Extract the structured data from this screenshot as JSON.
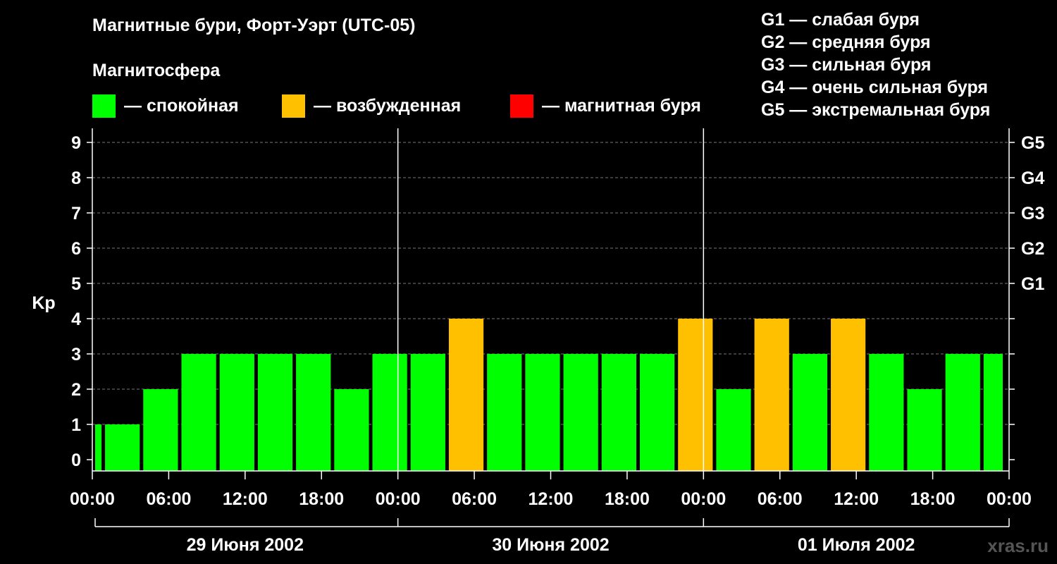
{
  "title": "Магнитные бури, Форт-Уэрт (UTC-05)",
  "magnetosphere_label": "Магнитосфера",
  "legend": [
    {
      "label": "— спокойная",
      "color": "#00ff00"
    },
    {
      "label": "— возбужденная",
      "color": "#ffc000"
    },
    {
      "label": "— магнитная буря",
      "color": "#ff0000"
    }
  ],
  "g_levels": [
    "G1 — слабая буря",
    "G2 — средняя буря",
    "G3 — сильная буря",
    "G4 — очень сильная буря",
    "G5 — экстремальная буря"
  ],
  "watermark": "xras.ru",
  "chart_data": {
    "type": "bar",
    "ylabel": "Kp",
    "ylim": [
      0,
      9
    ],
    "yticks": [
      0,
      1,
      2,
      3,
      4,
      5,
      6,
      7,
      8,
      9
    ],
    "right_ticks": [
      {
        "value": 5,
        "label": "G1"
      },
      {
        "value": 6,
        "label": "G2"
      },
      {
        "value": 7,
        "label": "G3"
      },
      {
        "value": 8,
        "label": "G4"
      },
      {
        "value": 9,
        "label": "G5"
      }
    ],
    "xlim_hours": [
      0,
      72
    ],
    "xtick_labels": [
      "00:00",
      "06:00",
      "12:00",
      "18:00",
      "00:00",
      "06:00",
      "12:00",
      "18:00",
      "00:00",
      "06:00",
      "12:00",
      "18:00",
      "00:00"
    ],
    "days": [
      "29 Июня 2002",
      "30 Июня 2002",
      "01 Июля 2002"
    ],
    "grid": "dashed horizontal",
    "quiet_color": "#00ff00",
    "active_color": "#ffc000",
    "storm_color": "#ff0000",
    "bars": [
      {
        "start_hour": -2,
        "end_hour": 1,
        "kp": 1
      },
      {
        "start_hour": 1,
        "end_hour": 4,
        "kp": 1
      },
      {
        "start_hour": 4,
        "end_hour": 7,
        "kp": 2
      },
      {
        "start_hour": 7,
        "end_hour": 10,
        "kp": 3
      },
      {
        "start_hour": 10,
        "end_hour": 13,
        "kp": 3
      },
      {
        "start_hour": 13,
        "end_hour": 16,
        "kp": 3
      },
      {
        "start_hour": 16,
        "end_hour": 19,
        "kp": 3
      },
      {
        "start_hour": 19,
        "end_hour": 22,
        "kp": 2
      },
      {
        "start_hour": 22,
        "end_hour": 25,
        "kp": 3
      },
      {
        "start_hour": 25,
        "end_hour": 28,
        "kp": 3
      },
      {
        "start_hour": 28,
        "end_hour": 31,
        "kp": 4
      },
      {
        "start_hour": 31,
        "end_hour": 34,
        "kp": 3
      },
      {
        "start_hour": 34,
        "end_hour": 37,
        "kp": 3
      },
      {
        "start_hour": 37,
        "end_hour": 40,
        "kp": 3
      },
      {
        "start_hour": 40,
        "end_hour": 43,
        "kp": 3
      },
      {
        "start_hour": 43,
        "end_hour": 46,
        "kp": 3
      },
      {
        "start_hour": 46,
        "end_hour": 49,
        "kp": 4
      },
      {
        "start_hour": 49,
        "end_hour": 52,
        "kp": 2
      },
      {
        "start_hour": 52,
        "end_hour": 55,
        "kp": 4
      },
      {
        "start_hour": 55,
        "end_hour": 58,
        "kp": 3
      },
      {
        "start_hour": 58,
        "end_hour": 61,
        "kp": 4
      },
      {
        "start_hour": 61,
        "end_hour": 64,
        "kp": 3
      },
      {
        "start_hour": 64,
        "end_hour": 67,
        "kp": 2
      },
      {
        "start_hour": 67,
        "end_hour": 70,
        "kp": 3
      },
      {
        "start_hour": 70,
        "end_hour": 73,
        "kp": 3
      }
    ]
  }
}
